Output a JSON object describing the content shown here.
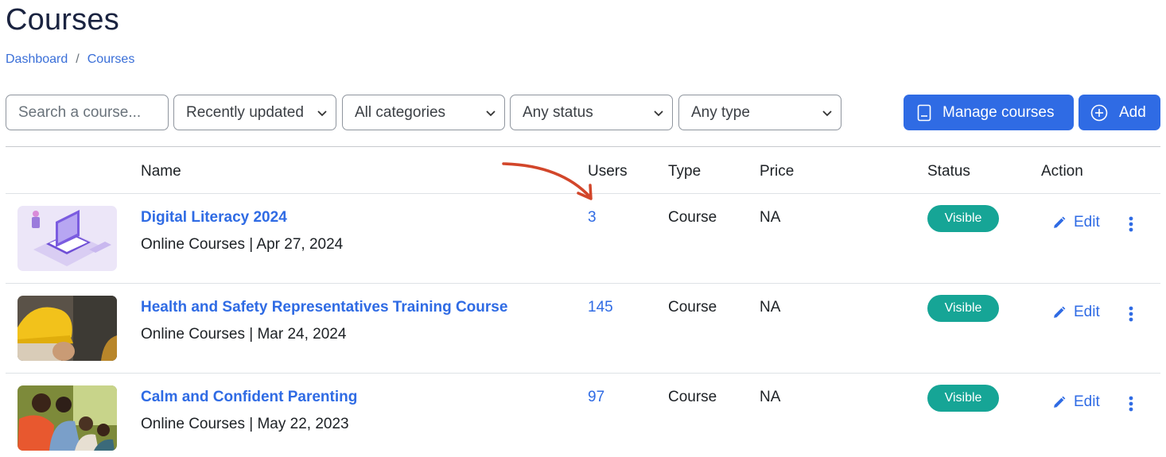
{
  "page": {
    "title": "Courses"
  },
  "breadcrumb": {
    "items": [
      "Dashboard",
      "Courses"
    ],
    "separator": "/"
  },
  "filters": {
    "search_placeholder": "Search a course...",
    "sort": "Recently updated",
    "category": "All categories",
    "status": "Any status",
    "type": "Any type"
  },
  "actions": {
    "manage_label": "Manage courses",
    "add_label": "Add"
  },
  "table": {
    "columns": [
      "Name",
      "Users",
      "Type",
      "Price",
      "Status",
      "Action"
    ],
    "rows": [
      {
        "name": "Digital Literacy 2024",
        "category": "Online Courses",
        "date": "Apr 27, 2024",
        "users": "3",
        "type": "Course",
        "price": "NA",
        "status": "Visible",
        "edit": "Edit"
      },
      {
        "name": "Health and Safety Representatives Training Course",
        "category": "Online Courses",
        "date": "Mar 24, 2024",
        "users": "145",
        "type": "Course",
        "price": "NA",
        "status": "Visible",
        "edit": "Edit"
      },
      {
        "name": "Calm and Confident Parenting",
        "category": "Online Courses",
        "date": "May 22, 2023",
        "users": "97",
        "type": "Course",
        "price": "NA",
        "status": "Visible",
        "edit": "Edit"
      }
    ]
  },
  "colors": {
    "primary": "#2f6be4",
    "visible_badge": "#16a596",
    "annotation_arrow": "#d2462a",
    "title": "#1a2340"
  },
  "icons": {
    "manage": "book-icon",
    "add": "plus-circle-icon",
    "edit": "pencil-icon",
    "more": "kebab-icon",
    "select": "chevron-down-icon"
  }
}
